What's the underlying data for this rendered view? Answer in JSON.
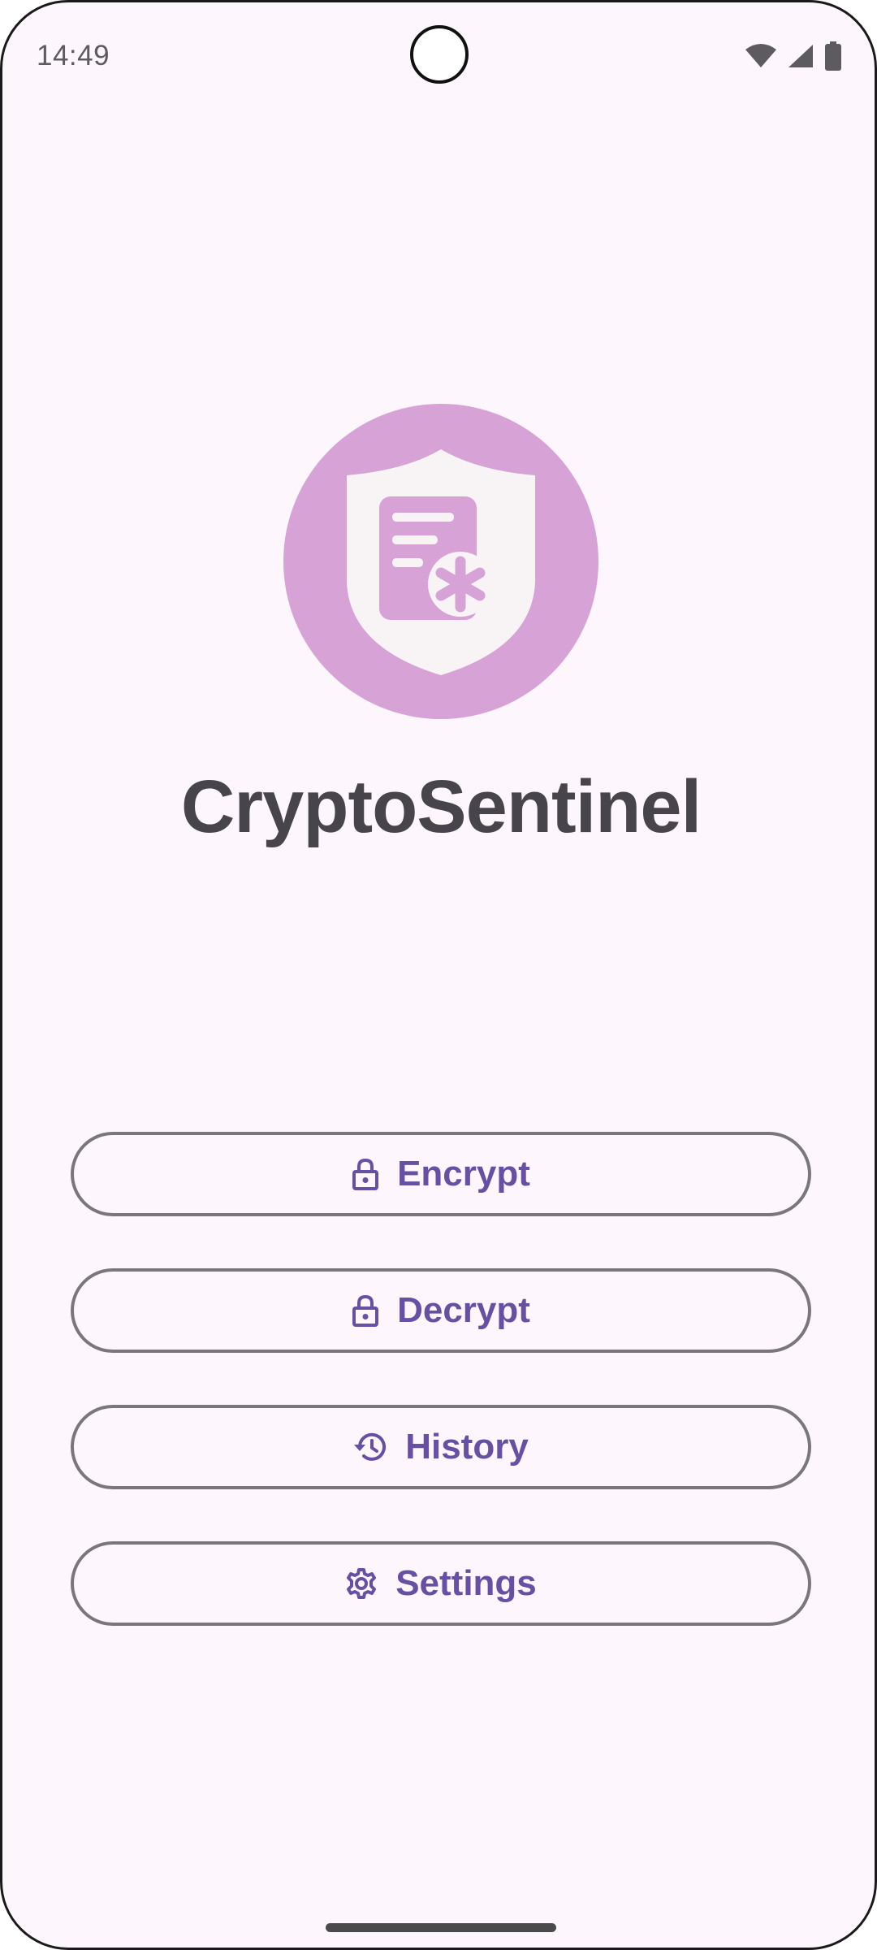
{
  "status_bar": {
    "time": "14:49"
  },
  "app": {
    "title": "CryptoSentinel",
    "logo_color": "#d7a2d5",
    "accent_color": "#6750a4"
  },
  "menu": {
    "items": [
      {
        "label": "Encrypt",
        "icon": "lock-icon"
      },
      {
        "label": "Decrypt",
        "icon": "lock-icon"
      },
      {
        "label": "History",
        "icon": "history-icon"
      },
      {
        "label": "Settings",
        "icon": "gear-icon"
      }
    ]
  }
}
